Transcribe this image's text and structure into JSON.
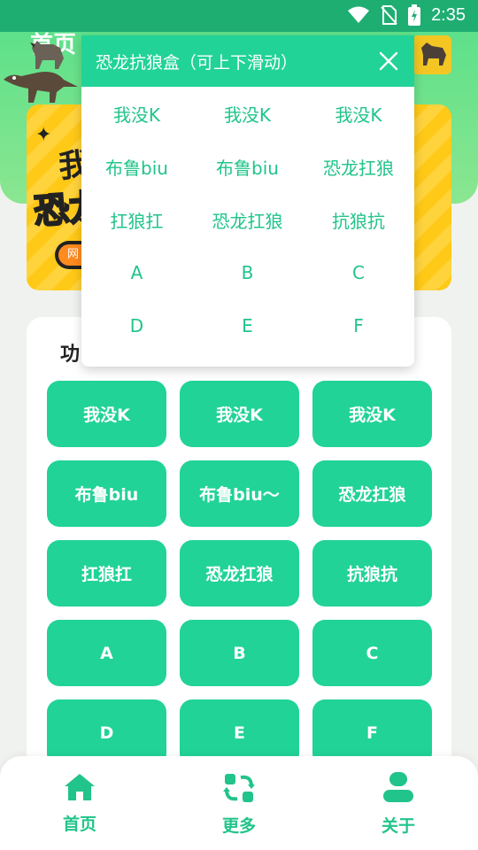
{
  "status": {
    "time": "2:35"
  },
  "header": {
    "title": "首页"
  },
  "banner": {
    "line1": "我",
    "line2": "恐龙",
    "pill": "网"
  },
  "section": {
    "title": "功"
  },
  "grid": [
    "我没K",
    "我没K",
    "我没K",
    "布鲁biu",
    "布鲁biu～",
    "恐龙扛狼",
    "扛狼扛",
    "恐龙扛狼",
    "抗狼抗",
    "A",
    "B",
    "C",
    "D",
    "E",
    "F"
  ],
  "popup": {
    "title": "恐龙抗狼盒（可上下滑动）",
    "items": [
      "我没K",
      "我没K",
      "我没K",
      "布鲁biu",
      "布鲁biu",
      "恐龙扛狼",
      "扛狼扛",
      "恐龙扛狼",
      "抗狼抗",
      "A",
      "B",
      "C",
      "D",
      "E",
      "F"
    ]
  },
  "nav": [
    {
      "label": "首页",
      "icon": "home-icon"
    },
    {
      "label": "更多",
      "icon": "refresh-icon"
    },
    {
      "label": "关于",
      "icon": "user-icon"
    }
  ],
  "colors": {
    "accent": "#21d396",
    "accent_text": "#21c48a",
    "status_bar": "#1fae72",
    "banner_yellow": "#ffc918"
  }
}
